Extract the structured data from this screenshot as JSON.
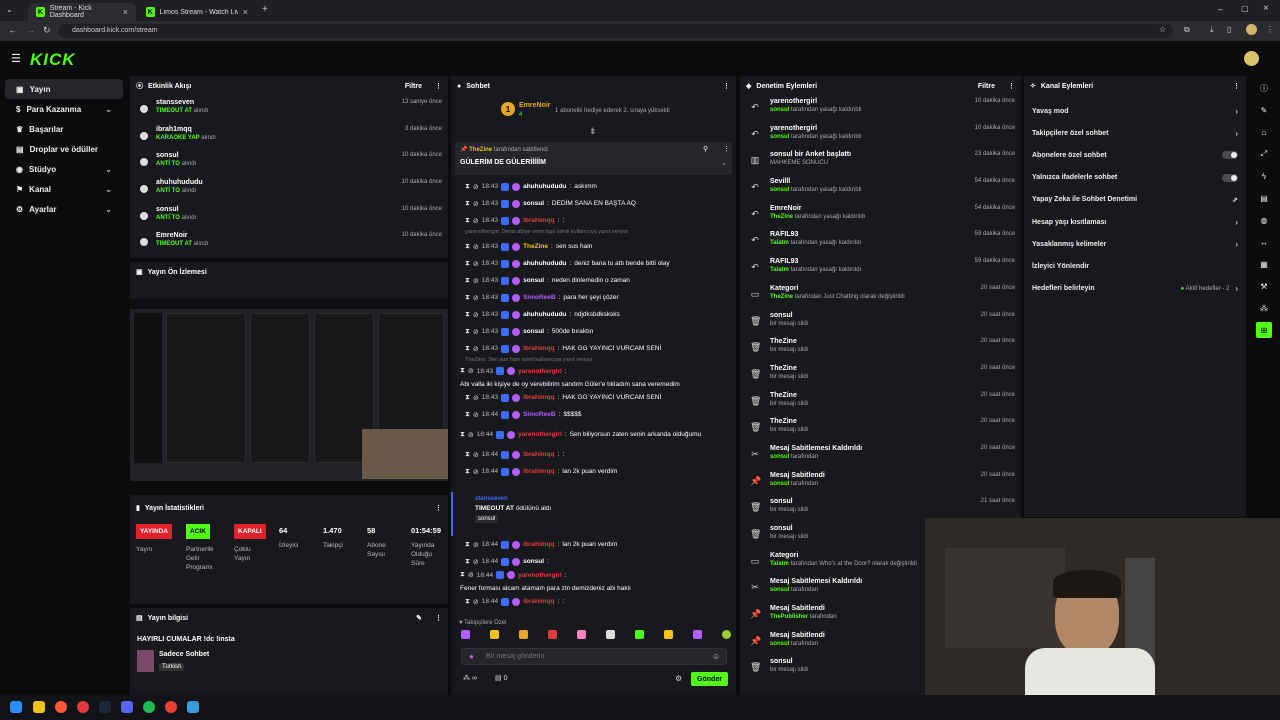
{
  "browser": {
    "tab1": "Stream - Kick Dashboard",
    "tab2": "Limos Stream - Watch Live on K",
    "url": "dashboard.kick.com/stream"
  },
  "logo": "KICK",
  "sidebar": {
    "items": [
      {
        "label": "Yayın"
      },
      {
        "label": "Para Kazanma"
      },
      {
        "label": "Başarılar"
      },
      {
        "label": "Droplar ve ödüller"
      },
      {
        "label": "Stüdyo"
      },
      {
        "label": "Kanal"
      },
      {
        "label": "Ayarlar"
      }
    ]
  },
  "activity": {
    "title": "Etkinlik Akışı",
    "filter": "Filtre",
    "items": [
      {
        "name": "stansseven",
        "action": "TIMEOUT AT",
        "suffix": "alındı",
        "time": "13 saniye önce"
      },
      {
        "name": "ibrah1mqq",
        "action": "KARAOKE YAP",
        "suffix": "alındı",
        "time": "3 dakika önce"
      },
      {
        "name": "sonsul",
        "action": "ANTİ TO",
        "suffix": "alındı",
        "time": "10 dakika önce"
      },
      {
        "name": "ahuhuhududu",
        "action": "ANTİ TO",
        "suffix": "alındı",
        "time": "10 dakika önce"
      },
      {
        "name": "sonsul",
        "action": "ANTİ TO",
        "suffix": "alındı",
        "time": "10 dakika önce"
      },
      {
        "name": "EmreNoir",
        "action": "TIMEOUT AT",
        "suffix": "alındı",
        "time": "10 dakika önce"
      }
    ]
  },
  "preview": {
    "title": "Yayın Ön İzlemesi"
  },
  "stats": {
    "title": "Yayın İstatistikleri",
    "yayin_badge": "YAYINDA",
    "yayin_label": "Yayın",
    "partner_badge": "ACIK",
    "partner_label": "Partnerlik Gelir Programı",
    "coklu_badge": "KAPALI",
    "coklu_label": "Çoklu Yayın",
    "izleyici": "64",
    "izleyici_label": "İzleyici",
    "takipci": "1.470",
    "takipci_label": "Takipçi",
    "abone": "58",
    "abone_label": "Abone Sayısı",
    "sure": "01:54:59",
    "sure_label": "Yayında Olduğu Süre"
  },
  "info": {
    "title": "Yayın bilgisi",
    "stream_title": "HAYIRLI CUMALAR !dc !insta",
    "category": "Sadece Sohbet",
    "tag": "Turkish"
  },
  "chat": {
    "title": "Sohbet",
    "gifter": "EmreNoir",
    "gift_count": "4",
    "gift_text": "1 abonelik hediye ederek 2. sıraya yükseldi",
    "pinned_by": "TheZine",
    "pinned_suffix": "tarafından sabitlendi",
    "pinned_msg": "GÜLERİM DE GÜLERİİİİİM",
    "messages": [
      {
        "time": "18:43",
        "user": "ahuhuhududu",
        "text": "askımm",
        "color": "#ffffff"
      },
      {
        "time": "18:43",
        "user": "sonsul",
        "text": "DEDİM SANA EN BAŞTA AQ",
        "color": "#ffffff"
      },
      {
        "time": "18:43",
        "user": "ibrahimqq",
        "text": ":",
        "color": "#e23b3b"
      },
      {
        "time": "18:43",
        "user": "TheZine",
        "text": "sen sus hain",
        "color": "#f0c419",
        "reply": "yarenothergirl: Deniz abiye verin lüşü isimli kullanıcıya yanıt veriyor"
      },
      {
        "time": "18:43",
        "user": "ahuhuhududu",
        "text": "deniz bana tu attı bende bitti olay",
        "color": "#ffffff"
      },
      {
        "time": "18:43",
        "user": "sonsul",
        "text": "neden dinlemedin o zaman",
        "color": "#ffffff"
      },
      {
        "time": "18:43",
        "user": "SimoReeB",
        "text": "para her şeyi çözer",
        "color": "#b45cff"
      },
      {
        "time": "18:43",
        "user": "ahuhuhududu",
        "text": "ndjdksbdksksks",
        "color": "#ffffff"
      },
      {
        "time": "18:43",
        "user": "sonsul",
        "text": "500de bıraktın",
        "color": "#ffffff"
      },
      {
        "time": "18:43",
        "user": "ibrahimqq",
        "text": "HAK GG YAYINCI VURCAM SENİ",
        "color": "#e23b3b"
      },
      {
        "time": "18:43",
        "user": "yarenothergirl",
        "text": "Abi valla iki kişiye de oy verebilirim sandım Güler'e tıkladım sana veremedim",
        "color": "#e23b3b",
        "reply": "TheZine: Sen sus hain isimli kullanıcıya yanıt veriyor"
      },
      {
        "time": "18:43",
        "user": "ibrahimqq",
        "text": "HAK GG YAYINCI VURCAM SENİ",
        "color": "#e23b3b"
      },
      {
        "time": "18:44",
        "user": "SimoReeB",
        "text": "$$$$$",
        "color": "#b45cff"
      },
      {
        "time": "18:44",
        "user": "yarenothergirl",
        "text": "Sen biliyorsun zaten senin arkanda olduğumu",
        "color": "#e23b3b"
      },
      {
        "time": "18:44",
        "user": "ibrahimqq",
        "text": ":",
        "color": "#e23b3b"
      },
      {
        "time": "18:44",
        "user": "ibrahimqq",
        "text": "lan 2k puan verdim",
        "color": "#e23b3b"
      }
    ],
    "redeem": {
      "user": "stansseven",
      "text": "TIMEOUT AT",
      "suffix": "ödülünü aldı",
      "target": "sonsul"
    },
    "messages2": [
      {
        "time": "18:44",
        "user": "ibrahimqq",
        "text": "lan 2k puan verdim",
        "color": "#e23b3b"
      },
      {
        "time": "18:44",
        "user": "sonsul",
        "text": "",
        "color": "#ffffff"
      },
      {
        "time": "18:44",
        "user": "yarenothergirl",
        "text": "Fener forması alcam atamam para ztn demizdeniz abi haklı",
        "color": "#e23b3b"
      },
      {
        "time": "18:44",
        "user": "ibrahimqq",
        "text": ":",
        "color": "#e23b3b"
      }
    ],
    "followers_only": "Takipçilere Özel",
    "placeholder": "Bir mesaj gönderin",
    "count": "0",
    "send": "Gönder"
  },
  "mod": {
    "title": "Denetim Eylemleri",
    "filter": "Filtre",
    "items": [
      {
        "icon": "↶",
        "name": "yarenothergirl",
        "by": "sonsul",
        "desc": "tarafından yasağı kaldırıldı",
        "time": "10 dakika önce"
      },
      {
        "icon": "↶",
        "name": "yarenothergirl",
        "by": "sonsul",
        "desc": "tarafından yasağı kaldırıldı",
        "time": "10 dakika önce"
      },
      {
        "icon": "▥",
        "name": "sonsul bir Anket başlattı",
        "by": "",
        "desc": "MAHKEME SONUCU",
        "time": "23 dakika önce"
      },
      {
        "icon": "↶",
        "name": "Sevilll",
        "by": "sonsul",
        "desc": "tarafından yasağı kaldırıldı",
        "time": "54 dakika önce"
      },
      {
        "icon": "↶",
        "name": "EmreNoir",
        "by": "TheZine",
        "desc": "tarafından yasağı kaldırıldı",
        "time": "54 dakika önce"
      },
      {
        "icon": "↶",
        "name": "RAFIL93",
        "by": "Talatm",
        "desc": "tarafından yasağı kaldırıldı",
        "time": "59 dakika önce"
      },
      {
        "icon": "↶",
        "name": "RAFIL93",
        "by": "Talatm",
        "desc": "tarafından yasağı kaldırıldı",
        "time": "59 dakika önce"
      },
      {
        "icon": "▭",
        "name": "Kategori",
        "by": "TheZine",
        "desc": "tarafından Just Chatting olarak değiştirildi",
        "time": "20 saat önce"
      },
      {
        "icon": "🗑",
        "name": "sonsul",
        "by": "",
        "desc": "bir mesajı sildi",
        "time": "20 saat önce"
      },
      {
        "icon": "🗑",
        "name": "TheZine",
        "by": "",
        "desc": "bir mesajı sildi",
        "time": "20 saat önce"
      },
      {
        "icon": "🗑",
        "name": "TheZine",
        "by": "",
        "desc": "bir mesajı sildi",
        "time": "20 saat önce"
      },
      {
        "icon": "🗑",
        "name": "TheZine",
        "by": "",
        "desc": "bir mesajı sildi",
        "time": "20 saat önce"
      },
      {
        "icon": "🗑",
        "name": "TheZine",
        "by": "",
        "desc": "bir mesajı sildi",
        "time": "20 saat önce"
      },
      {
        "icon": "✂",
        "name": "Mesaj Sabitlemesi Kaldırıldı",
        "by": "sonsul",
        "desc": "tarafından",
        "time": "20 saat önce"
      },
      {
        "icon": "📌",
        "name": "Mesaj Sabitlendi",
        "by": "sonsul",
        "desc": "tarafından",
        "time": "20 saat önce"
      },
      {
        "icon": "🗑",
        "name": "sonsul",
        "by": "",
        "desc": "bir mesajı sildi",
        "time": "21 saat önce"
      },
      {
        "icon": "🗑",
        "name": "sonsul",
        "by": "",
        "desc": "bir mesajı sildi",
        "time": ""
      },
      {
        "icon": "▭",
        "name": "Kategori",
        "by": "Talatm",
        "desc": "tarafından Who's at the Door? olarak değiştirildi",
        "time": ""
      },
      {
        "icon": "✂",
        "name": "Mesaj Sabitlemesi Kaldırıldı",
        "by": "sonsul",
        "desc": "tarafından",
        "time": ""
      },
      {
        "icon": "📌",
        "name": "Mesaj Sabitlendi",
        "by": "ThePublisher",
        "desc": "tarafından",
        "time": ""
      },
      {
        "icon": "📌",
        "name": "Mesaj Sabitlendi",
        "by": "sonsul",
        "desc": "tarafından",
        "time": ""
      },
      {
        "icon": "🗑",
        "name": "sonsul",
        "by": "",
        "desc": "bir mesajı sildi",
        "time": ""
      }
    ]
  },
  "channel": {
    "title": "Kanal Eylemleri",
    "items": [
      {
        "label": "Yavaş mod",
        "ctrl": "chev"
      },
      {
        "label": "Takipçilere özel sohbet",
        "ctrl": "chev"
      },
      {
        "label": "Abonelere özel sohbet",
        "ctrl": "toggle"
      },
      {
        "label": "Yalnızca ifadelerle sohbet",
        "ctrl": "toggle"
      },
      {
        "label": "Yapay Zeka ile Sohbet Denetimi",
        "ctrl": "ext"
      },
      {
        "label": "Hesap yaşı kısıtlaması",
        "ctrl": "chev"
      },
      {
        "label": "Yasaklanmış kelimeler",
        "ctrl": "chev"
      },
      {
        "label": "İzleyici Yönlendir",
        "ctrl": "none"
      },
      {
        "label": "Hedefleri belirleyin",
        "ctrl": "chev",
        "extra": "Aktif hedefler - 2"
      }
    ]
  },
  "colors": {
    "accent": "#53fc18",
    "panel": "#18191c",
    "bg": "#0b0c0d"
  }
}
